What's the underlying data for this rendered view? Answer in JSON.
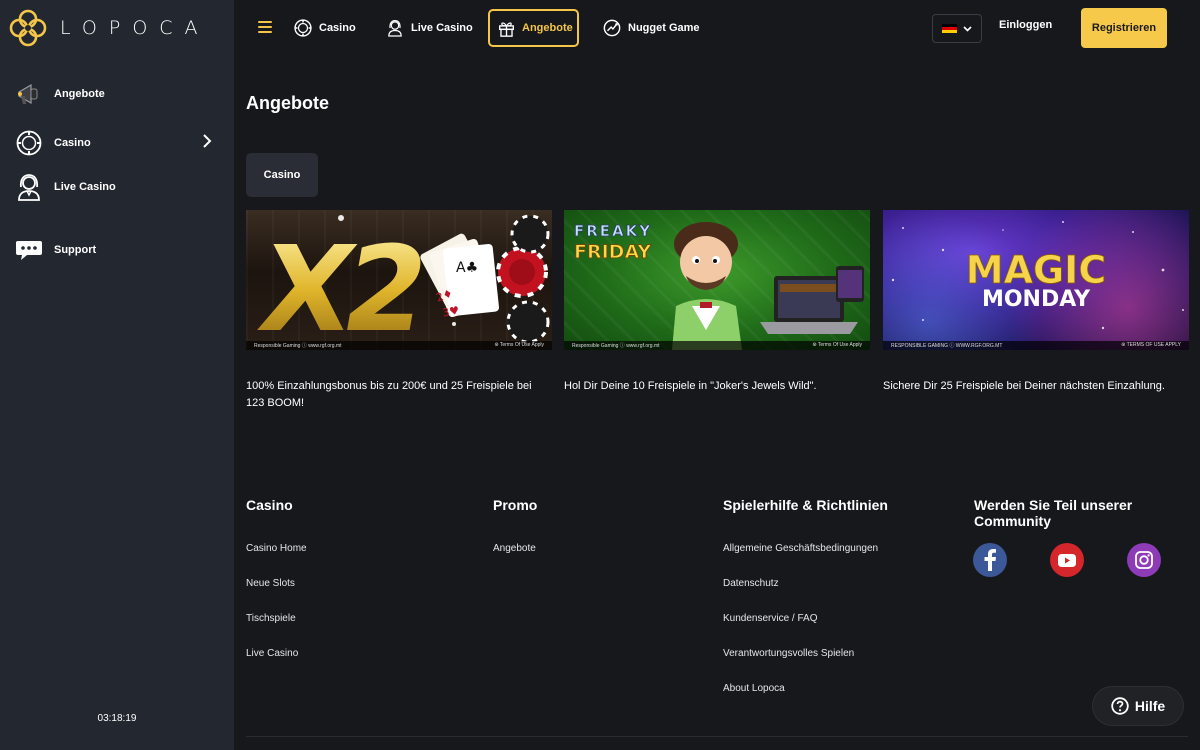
{
  "brand": {
    "name": "LOPOCA",
    "accent": "#f3c64a"
  },
  "sidebar": {
    "items": [
      {
        "label": "Angebote",
        "icon": "megaphone-icon"
      },
      {
        "label": "Casino",
        "icon": "chip-icon"
      },
      {
        "label": "Live Casino",
        "icon": "dealer-icon"
      },
      {
        "label": "Support",
        "icon": "chat-icon"
      }
    ],
    "clock": "03:18:19"
  },
  "topnav": {
    "items": [
      {
        "label": "Casino",
        "icon": "chip-icon",
        "active": false
      },
      {
        "label": "Live Casino",
        "icon": "dealer-icon",
        "active": false
      },
      {
        "label": "Angebote",
        "icon": "gift-icon",
        "active": true
      },
      {
        "label": "Nugget Game",
        "icon": "nugget-icon",
        "active": false
      }
    ],
    "language": "de",
    "login": "Einloggen",
    "register": "Registrieren"
  },
  "main": {
    "title": "Angebote",
    "tabs": [
      {
        "label": "Casino"
      }
    ],
    "promos": [
      {
        "banner_text": "X2",
        "fine_left": "Responsible Gaming ⓘ www.rgf.org.mt",
        "fine_right": "⊛ Terms Of Use Apply",
        "description": "100% Einzahlungsbonus bis zu 200€ und 25 Freispiele bei 123 BOOM!"
      },
      {
        "banner_text": "FREAKY FRIDAY",
        "fine_left": "Responsible Gaming ⓘ www.rgf.org.mt",
        "fine_right": "⊛ Terms Of Use Apply",
        "description": "Hol Dir Deine 10 Freispiele in \"Joker's Jewels Wild\"."
      },
      {
        "banner_text": "MAGIC MONDAY",
        "fine_left": "RESPONSIBLE GAMING ⓘ WWW.RGF.ORG.MT",
        "fine_right": "⊛ TERMS OF USE APPLY",
        "description": "Sichere Dir 25 Freispiele bei Deiner nächsten Einzahlung."
      }
    ]
  },
  "footer": {
    "columns": [
      {
        "title": "Casino",
        "links": [
          "Casino Home",
          "Neue Slots",
          "Tischspiele",
          "Live Casino"
        ]
      },
      {
        "title": "Promo",
        "links": [
          "Angebote"
        ]
      },
      {
        "title": "Spielerhilfe & Richtlinien",
        "links": [
          "Allgemeine Geschäftsbedingungen",
          "Datenschutz",
          "Kundenservice / FAQ",
          "Verantwortungsvolles Spielen",
          "About Lopoca"
        ]
      }
    ],
    "community": {
      "title": "Werden Sie Teil unserer Community",
      "networks": [
        {
          "name": "facebook",
          "icon": "facebook-icon",
          "color": "#3b5998"
        },
        {
          "name": "youtube",
          "icon": "youtube-icon",
          "color": "#d4262b"
        },
        {
          "name": "instagram",
          "icon": "instagram-icon",
          "color": "#8e3bb8"
        }
      ]
    }
  },
  "help": {
    "label": "Hilfe"
  }
}
